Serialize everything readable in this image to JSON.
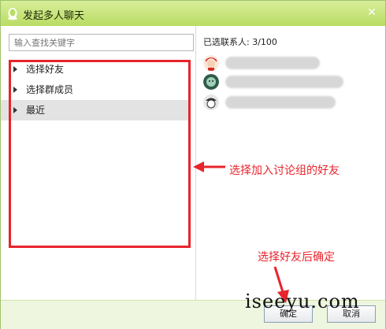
{
  "window": {
    "title": "发起多人聊天",
    "close_glyph": "✕"
  },
  "search": {
    "placeholder": "输入查找关键字"
  },
  "tree": {
    "items": [
      {
        "label": "选择好友",
        "selected": false
      },
      {
        "label": "选择群成员",
        "selected": false
      },
      {
        "label": "最近",
        "selected": true
      }
    ]
  },
  "selected": {
    "label": "已选联系人: 3/100",
    "contacts": [
      {
        "avatar": "red-hair-avatar"
      },
      {
        "avatar": "green-face-avatar"
      },
      {
        "avatar": "bw-hat-avatar"
      }
    ]
  },
  "buttons": {
    "ok": "确定",
    "cancel": "取消"
  },
  "annotations": {
    "middle": "选择加入讨论组的好友",
    "bottom": "选择好友后确定"
  },
  "watermark": "iseeyu.com",
  "colors": {
    "title_bar": "#b9dc62",
    "annotation_red": "#e8242c",
    "bottom_bar": "#eef6df"
  }
}
